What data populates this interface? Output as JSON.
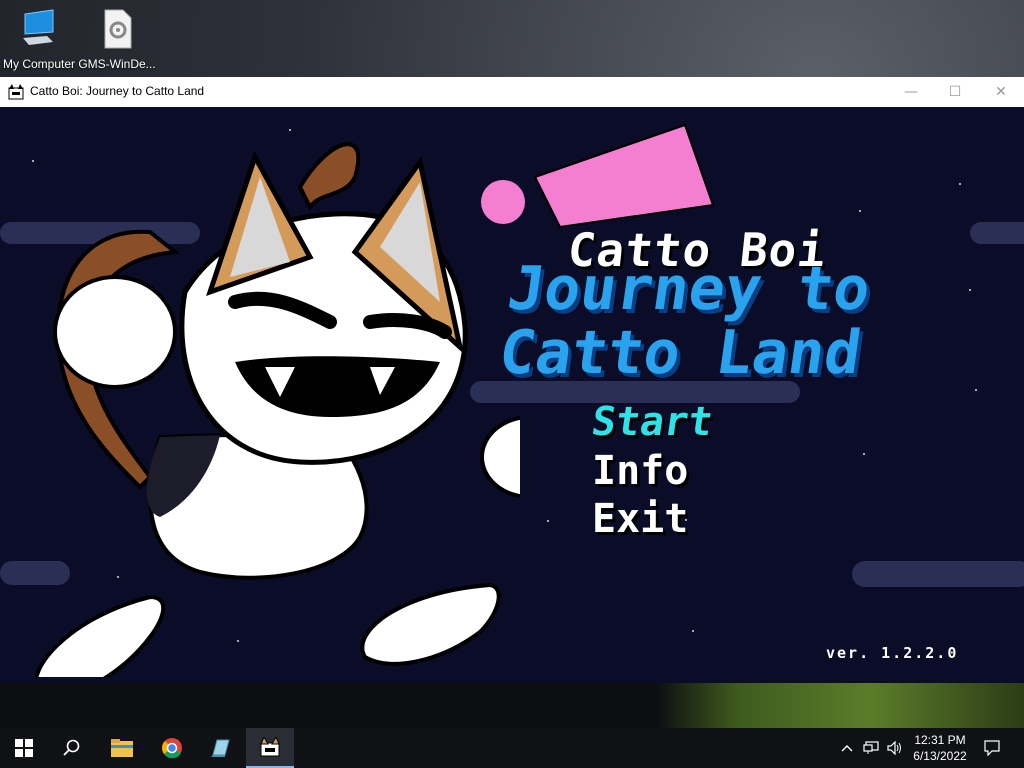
{
  "desktop": {
    "icons": [
      {
        "label": "My Computer",
        "icon": "monitor-icon"
      },
      {
        "label": "GMS-WinDe...",
        "icon": "settings-file-icon"
      }
    ]
  },
  "window": {
    "title": "Catto Boi: Journey to Catto Land",
    "controls": {
      "minimize": "—",
      "maximize": "☐",
      "close": "✕"
    }
  },
  "game": {
    "title_line1": "Catto Boi",
    "title_line2": "Journey to\nCatto Land",
    "menu": [
      {
        "label": "Start",
        "selected": true
      },
      {
        "label": "Info",
        "selected": false
      },
      {
        "label": "Exit",
        "selected": false
      }
    ],
    "version": "ver. 1.2.2.0",
    "colors": {
      "background": "#0b0c27",
      "title_blue": "#2aa3ee",
      "selected_cyan": "#2ee3e8",
      "pink": "#f47fd0"
    }
  },
  "taskbar": {
    "items": [
      "start-icon",
      "search-icon",
      "file-explorer-icon",
      "chrome-icon",
      "gamemaker-icon",
      "catto-boi-app-icon"
    ],
    "active_item": "catto-boi-app-icon",
    "clock": {
      "time": "12:31 PM",
      "date": "6/13/2022"
    },
    "tray": [
      "chevron-up-icon",
      "network-icon",
      "volume-icon",
      "notifications-icon"
    ]
  }
}
